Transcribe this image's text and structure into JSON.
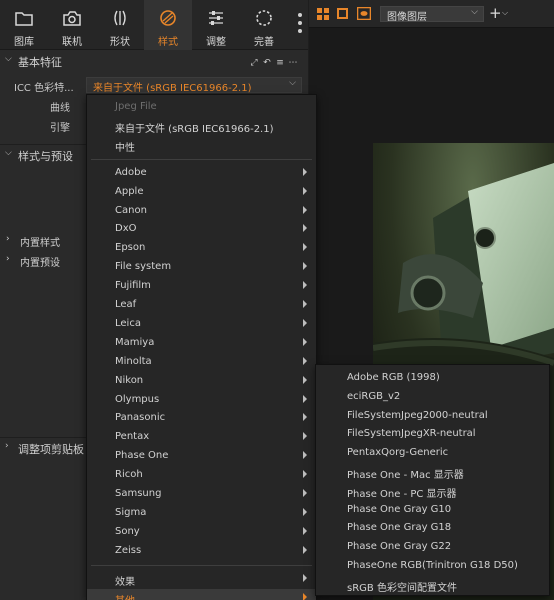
{
  "toolbar": {
    "tabs": [
      {
        "label": "图库",
        "icon": "folder-icon"
      },
      {
        "label": "联机",
        "icon": "camera-icon"
      },
      {
        "label": "形状",
        "icon": "lens-icon"
      },
      {
        "label": "样式",
        "icon": "style-icon",
        "active": true
      },
      {
        "label": "调整",
        "icon": "sliders-icon"
      },
      {
        "label": "完善",
        "icon": "refine-icon"
      }
    ]
  },
  "panel": {
    "basic_section_title": "基本特征",
    "icc_label": "ICC 色彩特...",
    "icc_value": "来自于文件 (sRGB IEC61966-2.1)",
    "curve_label": "曲线",
    "engine_label": "引擎",
    "styles_section_title": "样式与预设",
    "builtin_styles_label": "内置样式",
    "builtin_presets_label": "内置预设",
    "clipboard_section_title": "调整项剪贴板"
  },
  "viewer": {
    "layer_select": "图像图层",
    "add_layer": "+"
  },
  "menu": {
    "items": [
      {
        "label": "Jpeg File",
        "disabled": true
      },
      {
        "label": "来自于文件 (sRGB IEC61966-2.1)"
      },
      {
        "label": "中性"
      },
      {
        "label": "Adobe",
        "submenu": true
      },
      {
        "label": "Apple",
        "submenu": true
      },
      {
        "label": "Canon",
        "submenu": true
      },
      {
        "label": "DxO",
        "submenu": true
      },
      {
        "label": "Epson",
        "submenu": true
      },
      {
        "label": "File system",
        "submenu": true
      },
      {
        "label": "Fujifilm",
        "submenu": true
      },
      {
        "label": "Leaf",
        "submenu": true
      },
      {
        "label": "Leica",
        "submenu": true
      },
      {
        "label": "Mamiya",
        "submenu": true
      },
      {
        "label": "Minolta",
        "submenu": true
      },
      {
        "label": "Nikon",
        "submenu": true
      },
      {
        "label": "Olympus",
        "submenu": true
      },
      {
        "label": "Panasonic",
        "submenu": true
      },
      {
        "label": "Pentax",
        "submenu": true
      },
      {
        "label": "Phase One",
        "submenu": true
      },
      {
        "label": "Ricoh",
        "submenu": true
      },
      {
        "label": "Samsung",
        "submenu": true
      },
      {
        "label": "Sigma",
        "submenu": true
      },
      {
        "label": "Sony",
        "submenu": true
      },
      {
        "label": "Zeiss",
        "submenu": true
      },
      {
        "label": "效果",
        "submenu": true
      },
      {
        "label": "其他",
        "submenu": true,
        "highlight": true
      }
    ]
  },
  "submenu": {
    "items": [
      "Adobe RGB (1998)",
      "eciRGB_v2",
      "FileSystemJpeg2000-neutral",
      "FileSystemJpegXR-neutral",
      "PentaxQorg-Generic",
      "Phase One - Mac 显示器",
      "Phase One - PC 显示器",
      "Phase One Gray G10",
      "Phase One Gray G18",
      "Phase One Gray G22",
      "PhaseOne RGB(Trinitron G18 D50)",
      "sRGB 色彩空间配置文件"
    ]
  },
  "colors": {
    "accent": "#e8862a",
    "panel_bg": "#2a2a2a",
    "menu_bg": "#262626"
  }
}
